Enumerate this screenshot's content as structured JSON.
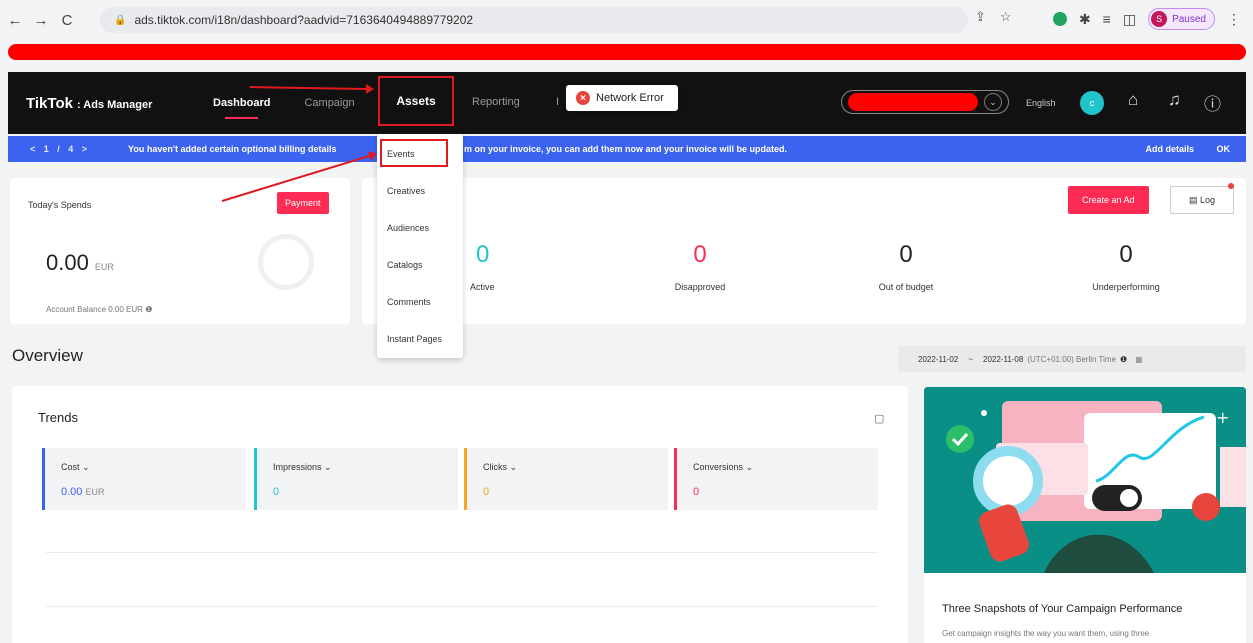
{
  "browser": {
    "url": "ads.tiktok.com/i18n/dashboard?aadvid=7163640494889779202",
    "profile_initial": "S",
    "profile_status": "Paused"
  },
  "header": {
    "logo": "TikTok",
    "logo_sub": ": Ads Manager",
    "nav": {
      "dashboard": "Dashboard",
      "campaign": "Campaign",
      "assets": "Assets",
      "reporting": "Reporting",
      "cut": "I"
    },
    "network_error": "Network Error",
    "language": "English",
    "avatar_initial": "c"
  },
  "banner": {
    "pager": "< 1 / 4 >",
    "message_part1": "You haven't added certain optional billing details",
    "message_part2": "m on your invoice, you can add them now and your invoice will be updated.",
    "add_details": "Add details",
    "ok": "OK"
  },
  "spend": {
    "label": "Today's Spends",
    "payment": "Payment",
    "amount": "0.00",
    "currency": "EUR",
    "balance": "Account Balance 0.00 EUR"
  },
  "status": {
    "create_ad": "Create an Ad",
    "log": "Log",
    "stats": [
      {
        "value": "0",
        "label": "Active",
        "color": "#20c4cb"
      },
      {
        "value": "0",
        "label": "Disapproved",
        "color": "#fe2c55"
      },
      {
        "value": "0",
        "label": "Out of budget",
        "color": "#222222"
      },
      {
        "value": "0",
        "label": "Underperforming",
        "color": "#222222"
      }
    ]
  },
  "assets_menu": {
    "items": [
      "Events",
      "Creatives",
      "Audiences",
      "Catalogs",
      "Comments",
      "Instant Pages"
    ]
  },
  "overview": {
    "title": "Overview",
    "date_start": "2022-11-02",
    "date_sep": "~",
    "date_end": "2022-11-08",
    "timezone": "(UTC+01:00) Berlin Time"
  },
  "trends": {
    "title": "Trends",
    "metrics": [
      {
        "name": "Cost",
        "value": "0.00",
        "unit": "EUR",
        "color": "#3c62f0"
      },
      {
        "name": "Impressions",
        "value": "0",
        "unit": "",
        "color": "#20c4cb"
      },
      {
        "name": "Clicks",
        "value": "0",
        "unit": "",
        "color": "#f5a623"
      },
      {
        "name": "Conversions",
        "value": "0",
        "unit": "",
        "color": "#fe2c55"
      }
    ]
  },
  "promo": {
    "title": "Three Snapshots of Your Campaign Performance",
    "text": "Get campaign insights the way you want them, using three"
  }
}
